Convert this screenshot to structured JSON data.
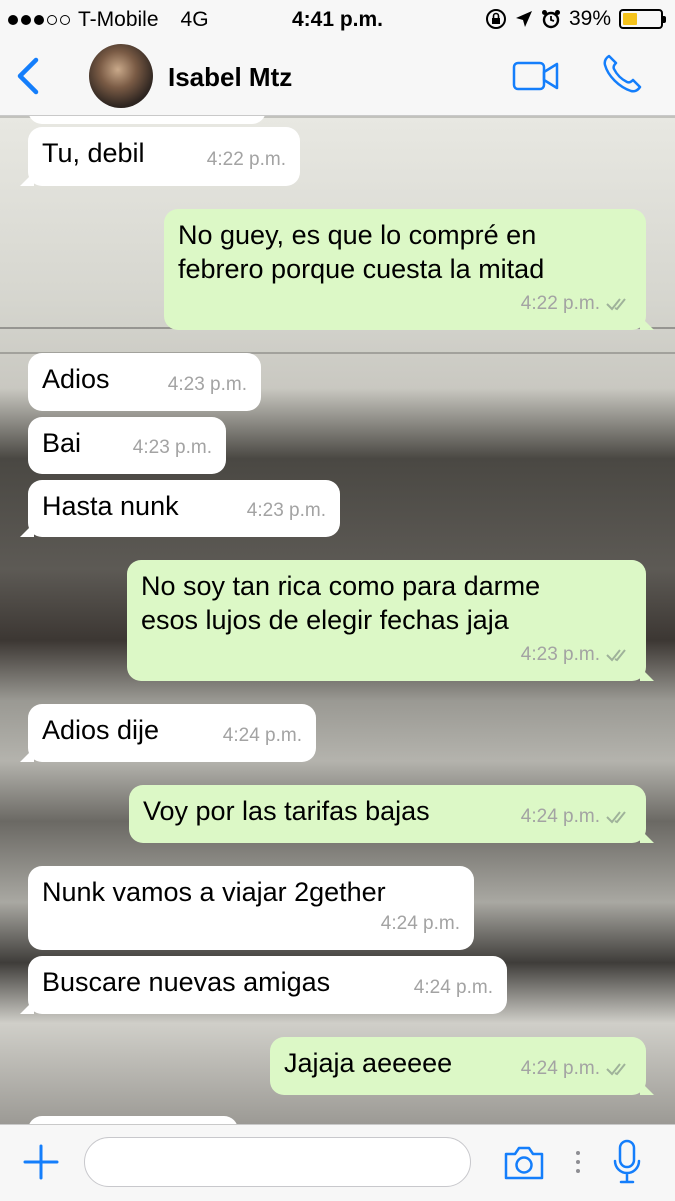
{
  "status_bar": {
    "carrier": "T-Mobile",
    "network": "4G",
    "time": "4:41 p.m.",
    "battery": "39%",
    "signal_filled": 3,
    "signal_total": 5,
    "battery_level": 0.39
  },
  "header": {
    "contact_name": "Isabel Mtz"
  },
  "messages": [
    {
      "dir": "in",
      "text": "Tu, debil",
      "time": "4:22 p.m."
    },
    {
      "dir": "out",
      "text": "No guey, es que lo compré en\nfebrero porque cuesta la mitad",
      "time": "4:22 p.m."
    },
    {
      "dir": "in",
      "text": "Adios",
      "time": "4:23 p.m."
    },
    {
      "dir": "in",
      "text": "Bai",
      "time": "4:23 p.m."
    },
    {
      "dir": "in",
      "text": "Hasta nunk",
      "time": "4:23 p.m."
    },
    {
      "dir": "out",
      "text": "No soy tan rica como para darme\nesos lujos de elegir fechas jaja",
      "time": "4:23 p.m."
    },
    {
      "dir": "in",
      "text": "Adios dije",
      "time": "4:24 p.m."
    },
    {
      "dir": "out",
      "text": "Voy por las tarifas bajas",
      "time": "4:24 p.m."
    },
    {
      "dir": "in",
      "text": "Nunk vamos a viajar 2gether",
      "time": "4:24 p.m."
    },
    {
      "dir": "in",
      "text": "Buscare nuevas amigas",
      "time": "4:24 p.m."
    },
    {
      "dir": "out",
      "text": "Jajaja aeeeee",
      "time": "4:24 p.m."
    }
  ],
  "input": {
    "value": "",
    "placeholder": ""
  },
  "colors": {
    "accent": "#147efb",
    "outgoing_bubble": "#dcf8c6",
    "incoming_bubble": "#ffffff",
    "battery_fill": "#f4c21b"
  },
  "icons": {
    "back": "chevron-left-icon",
    "video": "video-camera-icon",
    "phone": "phone-icon",
    "plus": "plus-icon",
    "camera": "camera-icon",
    "mic": "microphone-icon",
    "read": "double-check-icon"
  }
}
